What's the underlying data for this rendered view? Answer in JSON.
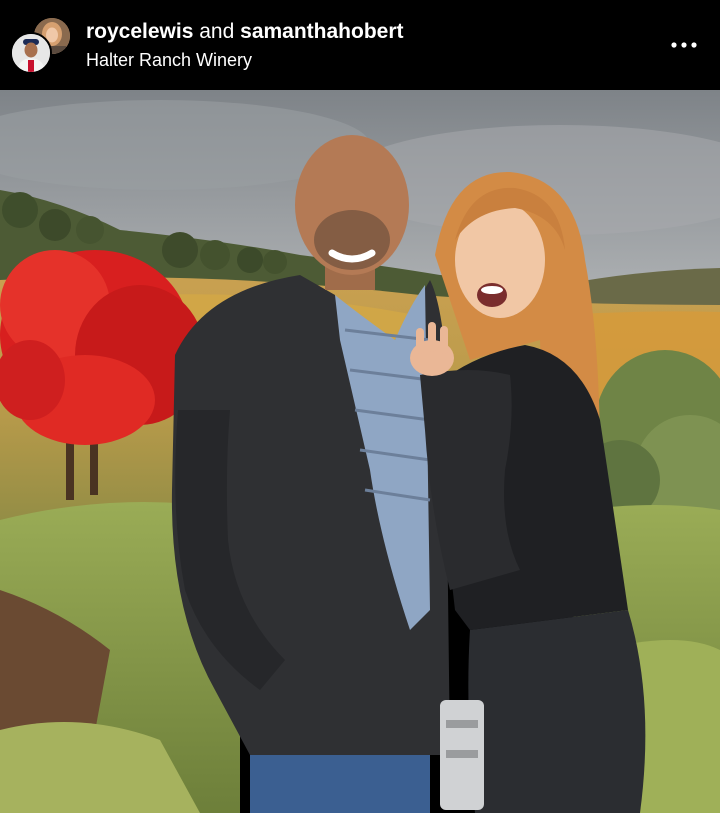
{
  "post": {
    "author_primary": "roycelewis",
    "joiner": "and",
    "author_secondary": "samanthahobert",
    "location": "Halter Ranch Winery",
    "more_icon": "more-horizontal-icon"
  },
  "photo": {
    "subject": "couple-engagement-photo-vineyard",
    "colors": {
      "sky": "#8f9498",
      "foliage_red": "#e01e1e",
      "vineyard_gold": "#d9a645",
      "grass_green": "#8ea24a",
      "jacket": "#2f3033",
      "sweater": "#1e1f22",
      "hair": "#d7924a"
    }
  }
}
